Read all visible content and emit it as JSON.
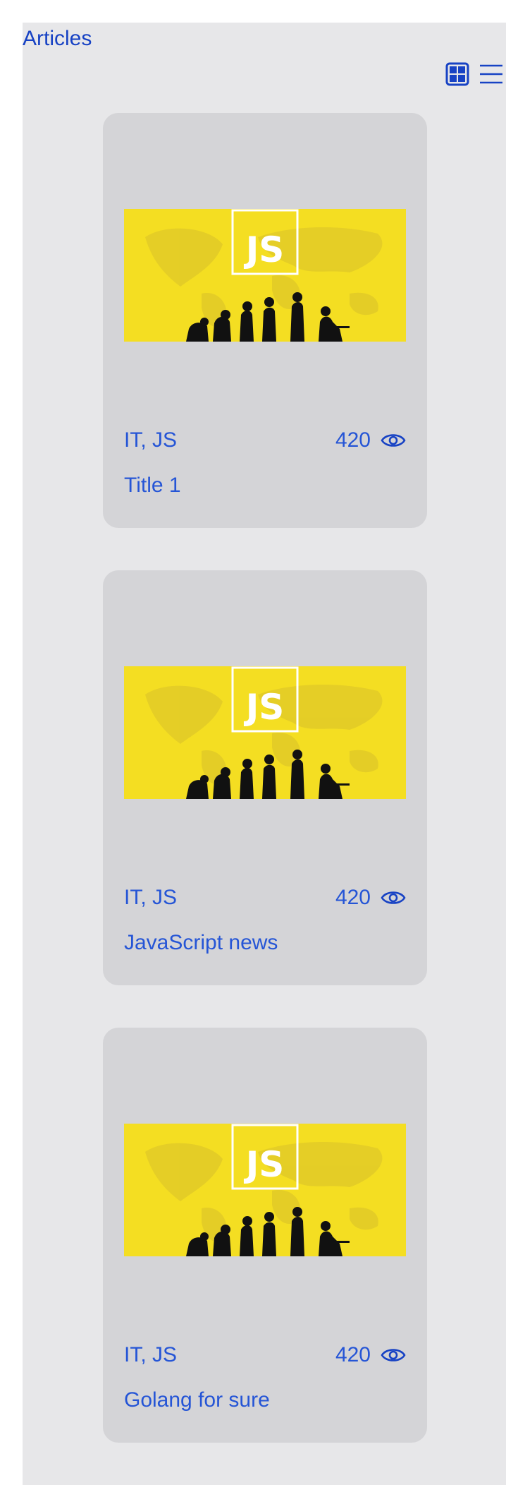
{
  "header": {
    "title": "Articles",
    "views": [
      {
        "name": "grid-view",
        "icon": "grid-icon"
      },
      {
        "name": "list-view",
        "icon": "list-icon"
      }
    ]
  },
  "articles": [
    {
      "tags": "IT, JS",
      "views": "420",
      "title": "Title 1",
      "image_logo": "JS"
    },
    {
      "tags": "IT, JS",
      "views": "420",
      "title": "JavaScript news",
      "image_logo": "JS"
    },
    {
      "tags": "IT, JS",
      "views": "420",
      "title": "Golang for sure",
      "image_logo": "JS"
    }
  ],
  "colors": {
    "accent": "#1742c4",
    "page_bg": "#e7e7e9",
    "card_bg": "#d4d4d7",
    "image_yellow": "#f4de22"
  }
}
